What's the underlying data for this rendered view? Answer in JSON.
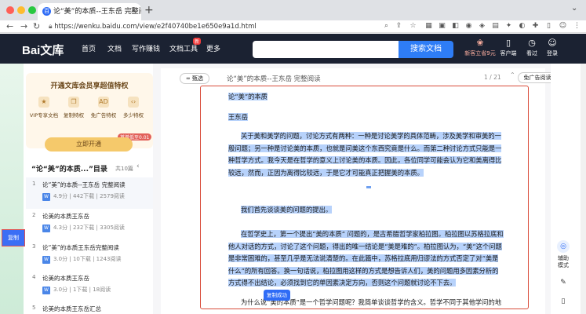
{
  "browser": {
    "tab_title": "论“美”的本质--王东岳 完整阅读",
    "url": "https://wenku.baidu.com/view/e2f40740be1e650e9a1d.html",
    "new_tab_symbol": "+",
    "close_symbol": "×"
  },
  "header": {
    "logo": "Bai文库",
    "nav": [
      "首页",
      "文档",
      "写作赚钱",
      "文档工具",
      "更多"
    ],
    "nav_badge": "新",
    "search_placeholder": "",
    "search_button": "搜索文档",
    "promo": "新客立省9元",
    "icons": [
      "客户端",
      "看过",
      "登录"
    ]
  },
  "vip": {
    "title": "开通文库会员享超值特权",
    "perks": [
      "VIP专享文档",
      "复制特权",
      "免广告特权",
      "多少特权"
    ],
    "tag": "首单低至0.01",
    "button": "立即开通"
  },
  "toc": {
    "title": "“论“美”的本质...”目录",
    "count": "共10篇",
    "items": [
      {
        "num": "1",
        "title": "论“美”的本质--王东岳 完整阅读",
        "meta": "4.9分   |   442下载   |   2579阅读"
      },
      {
        "num": "2",
        "title": "论美的本质王东岳",
        "meta": "4.3分   |   232下载   |   3305阅读"
      },
      {
        "num": "3",
        "title": "论“美”的本质王东岳完整阅读",
        "meta": "3.0分   |   10下载   |   1243阅读"
      },
      {
        "num": "4",
        "title": "论美的本质王东岳",
        "meta": "3.0分   |   1下载   |   18阅读"
      },
      {
        "num": "5",
        "title": "论美的本质王东岳汇总",
        "meta": ""
      }
    ]
  },
  "side_copy": "复制",
  "reader": {
    "pill": "甄选",
    "title": "论“美”的本质--王东岳 完整阅读",
    "pages": "1 / 21",
    "ad_button": "免广告阅读",
    "copy_popup": "复制成功",
    "paragraphs": [
      "论“美”的本质",
      "王东岳",
      "关于美和美学的问题，讨论方式有两种：一种是讨论美学的具体范畴，涉及美学和审美的一般问题；另一种是讨论美的本质，也就是问美这个东西究竟是什么。而第二种讨论方式只能是一种哲学方式。我今天是在哲学的意义上讨论美的本质。因此，各位同学可能会认为它和美离得比较远，然而，正因为离得比较远，于是它才可能真正把握美的本质。",
      "我们首先谈谈美的问题的提出。",
      "在哲学史上，第一个提出“美的本质” 问题的，是古希腊哲学家柏拉图。柏拉图以苏格拉底和他人对话的方式，讨论了这个问题，得出的唯一结论是“美是难的”。柏拉图认为，“美”这个问题是非常困难的，甚至几乎是无法说清楚的。在此篇中，苏格拉底用归谬法的方式否定了对“美是什么”的所有回答。换一句话说，柏拉图用这样的方式是想告诉人们，美的问题用多因素分析的方式得不出结论，必须找到它的单因素决定方向，否则这个问题就讨论不下去。",
      "为什么说“美的本质”是一个哲学问题呢？我简单谈谈哲学的含义。哲学不同于其他学问的地方，就在于哲学追究将终极原因的学问，也就是说，它不在一般的意义上讨论"
    ]
  },
  "right_rail": [
    "辅助模式"
  ],
  "colors": {
    "header_bg": "#1b2232",
    "accent": "#2f6cf6",
    "selection": "#b7d2fb",
    "highlight_border": "#d94c3a"
  }
}
